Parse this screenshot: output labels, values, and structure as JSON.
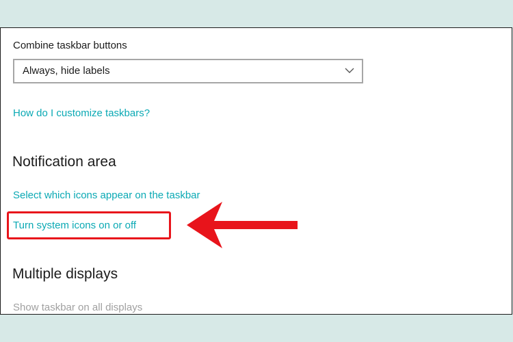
{
  "taskbar": {
    "combine_label": "Combine taskbar buttons",
    "combine_value": "Always, hide labels",
    "customize_link": "How do I customize taskbars?"
  },
  "notification_area": {
    "title": "Notification area",
    "select_icons_link": "Select which icons appear on the taskbar",
    "system_icons_link": "Turn system icons on or off"
  },
  "multiple_displays": {
    "title": "Multiple displays",
    "show_all_label": "Show taskbar on all displays"
  },
  "colors": {
    "link": "#0aa9b4",
    "annotation": "#e8141b",
    "background": "#d7e9e7"
  },
  "icons": {
    "dropdown": "chevron-down-icon",
    "annotation_arrow": "red-left-arrow-icon"
  }
}
